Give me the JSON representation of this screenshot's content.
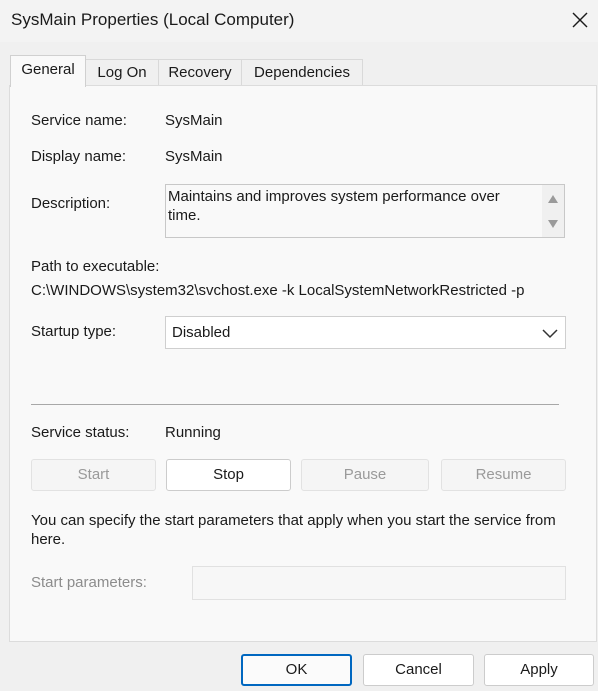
{
  "window": {
    "title": "SysMain Properties (Local Computer)"
  },
  "tabs": [
    {
      "label": "General",
      "active": true
    },
    {
      "label": "Log On",
      "active": false
    },
    {
      "label": "Recovery",
      "active": false
    },
    {
      "label": "Dependencies",
      "active": false
    }
  ],
  "general": {
    "service_name_label": "Service name:",
    "service_name_value": "SysMain",
    "display_name_label": "Display name:",
    "display_name_value": "SysMain",
    "description_label": "Description:",
    "description_value": "Maintains and improves system performance over time.",
    "path_label": "Path to executable:",
    "path_value": "C:\\WINDOWS\\system32\\svchost.exe -k LocalSystemNetworkRestricted -p",
    "startup_type_label": "Startup type:",
    "startup_type_value": "Disabled",
    "service_status_label": "Service status:",
    "service_status_value": "Running",
    "buttons": {
      "start": "Start",
      "stop": "Stop",
      "pause": "Pause",
      "resume": "Resume"
    },
    "info_text": "You can specify the start parameters that apply when you start the service from here.",
    "start_params_label": "Start parameters:",
    "start_params_value": ""
  },
  "footer": {
    "ok": "OK",
    "cancel": "Cancel",
    "apply": "Apply"
  },
  "colors": {
    "accent": "#0067c0",
    "window_bg": "#f0f0f0",
    "panel_bg": "#f9f9f9"
  }
}
